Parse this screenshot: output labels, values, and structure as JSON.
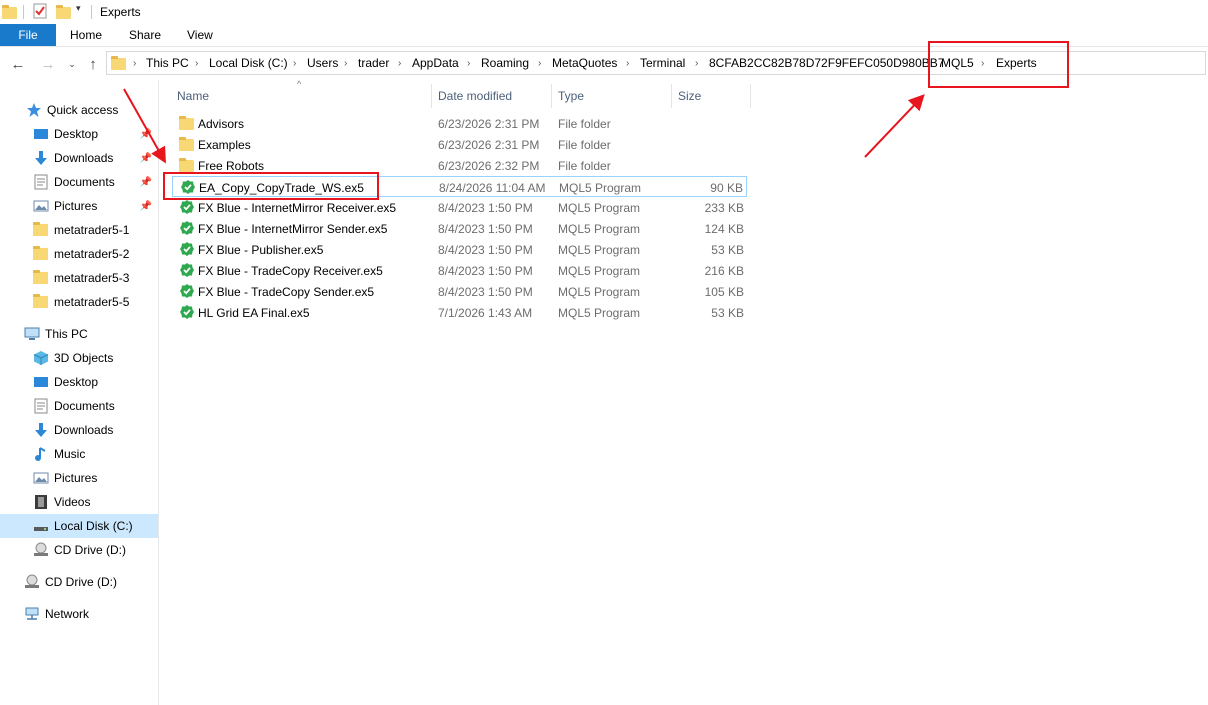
{
  "window": {
    "title": "Experts"
  },
  "ribbon": {
    "tabs": [
      "File",
      "Home",
      "Share",
      "View"
    ]
  },
  "breadcrumbs": [
    "This PC",
    "Local Disk (C:)",
    "Users",
    "trader",
    "AppData",
    "Roaming",
    "MetaQuotes",
    "Terminal",
    "8CFAB2CC82B78D72F9FEFC050D980BB7",
    "MQL5",
    "Experts"
  ],
  "sidebar": {
    "quick_access": {
      "label": "Quick access",
      "items": [
        {
          "label": "Desktop",
          "icon": "desktop-icon",
          "pinned": true
        },
        {
          "label": "Downloads",
          "icon": "downloads-icon",
          "pinned": true
        },
        {
          "label": "Documents",
          "icon": "documents-icon",
          "pinned": true
        },
        {
          "label": "Pictures",
          "icon": "pictures-icon",
          "pinned": true
        },
        {
          "label": "metatrader5-1",
          "icon": "folder-icon"
        },
        {
          "label": "metatrader5-2",
          "icon": "folder-icon"
        },
        {
          "label": "metatrader5-3",
          "icon": "folder-icon"
        },
        {
          "label": "metatrader5-5",
          "icon": "folder-icon"
        }
      ]
    },
    "this_pc": {
      "label": "This PC",
      "items": [
        {
          "label": "3D Objects",
          "icon": "3d-objects-icon"
        },
        {
          "label": "Desktop",
          "icon": "desktop-icon"
        },
        {
          "label": "Documents",
          "icon": "documents-icon"
        },
        {
          "label": "Downloads",
          "icon": "downloads-icon"
        },
        {
          "label": "Music",
          "icon": "music-icon"
        },
        {
          "label": "Pictures",
          "icon": "pictures-icon"
        },
        {
          "label": "Videos",
          "icon": "videos-icon"
        },
        {
          "label": "Local Disk (C:)",
          "icon": "local-disk-icon",
          "selected": true
        },
        {
          "label": "CD Drive (D:)",
          "icon": "cd-drive-icon"
        }
      ]
    },
    "cd_drive": {
      "label": "CD Drive (D:)"
    },
    "network": {
      "label": "Network"
    }
  },
  "columns": {
    "name": "Name",
    "date": "Date modified",
    "type": "Type",
    "size": "Size"
  },
  "files": [
    {
      "name": "Advisors",
      "date": "6/23/2026 2:31 PM",
      "type": "File folder",
      "size": "",
      "icon": "folder-icon"
    },
    {
      "name": "Examples",
      "date": "6/23/2026 2:31 PM",
      "type": "File folder",
      "size": "",
      "icon": "folder-icon"
    },
    {
      "name": "Free Robots",
      "date": "6/23/2026 2:32 PM",
      "type": "File folder",
      "size": "",
      "icon": "folder-icon"
    },
    {
      "name": "EA_Copy_CopyTrade_WS.ex5",
      "date": "8/24/2026 11:04 AM",
      "type": "MQL5 Program",
      "size": "90 KB",
      "icon": "mql5-program-icon",
      "selected": true
    },
    {
      "name": "FX Blue - InternetMirror Receiver.ex5",
      "date": "8/4/2023 1:50 PM",
      "type": "MQL5 Program",
      "size": "233 KB",
      "icon": "mql5-program-icon"
    },
    {
      "name": "FX Blue - InternetMirror Sender.ex5",
      "date": "8/4/2023 1:50 PM",
      "type": "MQL5 Program",
      "size": "124 KB",
      "icon": "mql5-program-icon"
    },
    {
      "name": "FX Blue - Publisher.ex5",
      "date": "8/4/2023 1:50 PM",
      "type": "MQL5 Program",
      "size": "53 KB",
      "icon": "mql5-program-icon"
    },
    {
      "name": "FX Blue - TradeCopy Receiver.ex5",
      "date": "8/4/2023 1:50 PM",
      "type": "MQL5 Program",
      "size": "216 KB",
      "icon": "mql5-program-icon"
    },
    {
      "name": "FX Blue - TradeCopy Sender.ex5",
      "date": "8/4/2023 1:50 PM",
      "type": "MQL5 Program",
      "size": "105 KB",
      "icon": "mql5-program-icon"
    },
    {
      "name": "HL Grid EA Final.ex5",
      "date": "7/1/2026 1:43 AM",
      "type": "MQL5 Program",
      "size": "53 KB",
      "icon": "mql5-program-icon"
    }
  ],
  "colors": {
    "accent": "#1979ca",
    "annotation": "#e8141e",
    "selection": "#cce8ff",
    "mql5_icon": "#2fa84f"
  }
}
